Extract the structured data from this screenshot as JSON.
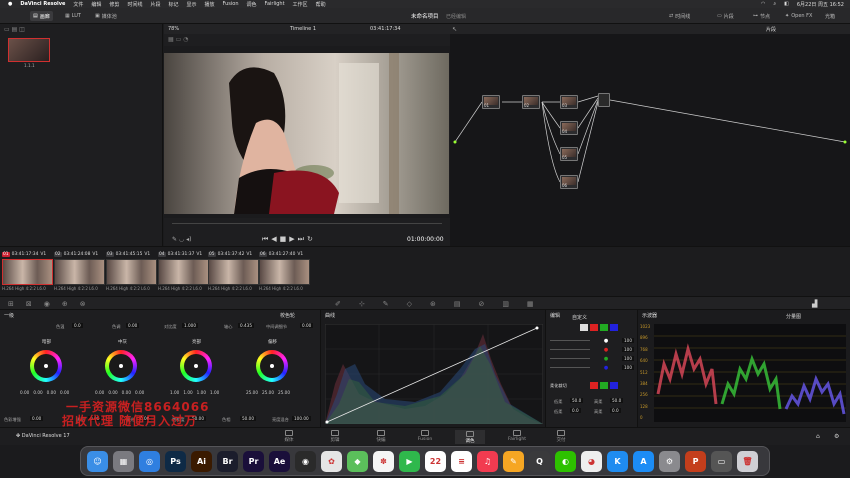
{
  "menubar": {
    "app": "DaVinci Resolve",
    "items": [
      "文件",
      "编辑",
      "修剪",
      "时间线",
      "片段",
      "标记",
      "显示",
      "播放",
      "Fusion",
      "调色",
      "Fairlight",
      "工作区",
      "帮助"
    ],
    "clock": "6月22日 周五 16:52"
  },
  "toolbar": {
    "media_pool": "画廊",
    "lut": "LUT",
    "media": "媒体池",
    "project_title": "未命名项目",
    "edited": "已经编辑",
    "timeline_label": "时间线",
    "clips": "片段",
    "nodes": "节点",
    "openfx": "Open FX",
    "lightbox": "光箱"
  },
  "gallery": {
    "still_label": "1.1.1"
  },
  "viewer": {
    "zoom": "78%",
    "timeline": "Timeline 1",
    "timecode_top": "03:41:17:34",
    "clip_label": "视频片段",
    "timecode": "01:00:00:00"
  },
  "nodes_panel": {
    "mode": "片段",
    "node_labels": [
      "01",
      "02",
      "03",
      "04",
      "05",
      "06"
    ]
  },
  "clips": [
    {
      "num": "01",
      "tc": "03:41:17:34",
      "track": "V1",
      "codec": "H.264 High 4:2:2 L6.0"
    },
    {
      "num": "02",
      "tc": "03:41:24:08",
      "track": "V1",
      "codec": "H.264 High 4:2:2 L6.0"
    },
    {
      "num": "03",
      "tc": "03:41:45:15",
      "track": "V1",
      "codec": "H.264 High 4:2:2 L6.0"
    },
    {
      "num": "04",
      "tc": "03:41:31:37",
      "track": "V1",
      "codec": "H.264 High 4:2:2 L6.0"
    },
    {
      "num": "05",
      "tc": "03:41:37:42",
      "track": "V1",
      "codec": "H.264 High 4:2:2 L6.0"
    },
    {
      "num": "06",
      "tc": "03:41:27:40",
      "track": "V1",
      "codec": "H.264 High 4:2:2 L6.0"
    }
  ],
  "wheels_panel": {
    "title": "一级",
    "mode": "校色轮",
    "contrast_label": "色温",
    "contrast": "0.0",
    "tint_label": "色调",
    "tint": "0.00",
    "cont_label": "对比度",
    "cont": "1.000",
    "pivot_label": "轴心",
    "pivot": "0.435",
    "mid_label": "中间调细节",
    "mid": "0.00",
    "wheels": [
      {
        "label": "暗部",
        "values": [
          "0.00",
          "0.00",
          "0.00",
          "0.00"
        ]
      },
      {
        "label": "中灰",
        "values": [
          "0.00",
          "0.00",
          "0.00",
          "0.00"
        ]
      },
      {
        "label": "亮部",
        "values": [
          "1.00",
          "1.00",
          "1.00",
          "1.00"
        ]
      },
      {
        "label": "偏移",
        "values": [
          "25.00",
          "25.00",
          "25.00"
        ]
      }
    ],
    "bottom": {
      "b1_label": "色彩增强",
      "b1": "0.00",
      "b2_label": "阴影",
      "b2": "0.00",
      "b3_label": "高光",
      "b3": "0.00",
      "b4_label": "饱和度",
      "b4": "50.00",
      "b5_label": "色相",
      "b5": "50.00",
      "b6_label": "亮度混合",
      "b6": "100.00"
    }
  },
  "curves_panel": {
    "title": "曲线"
  },
  "curves_rgb": {
    "edit_label": "编辑",
    "mode": "自定义",
    "values": [
      "100",
      "100",
      "100",
      "100"
    ],
    "soft_label": "柔化裁切",
    "low_label": "低柔",
    "low": "50.0",
    "high_label": "高柔",
    "high": "50.0",
    "ls_label": "低柔",
    "ls": "0.0",
    "hs_label": "高柔",
    "hs": "0.0"
  },
  "scopes_panel": {
    "title": "示波器",
    "mode": "分量图",
    "ticks": [
      "1023",
      "896",
      "768",
      "640",
      "512",
      "384",
      "256",
      "128",
      "0"
    ]
  },
  "pages": [
    {
      "label": "媒体"
    },
    {
      "label": "剪辑"
    },
    {
      "label": "快编"
    },
    {
      "label": "Fusion"
    },
    {
      "label": "调色"
    },
    {
      "label": "Fairlight"
    },
    {
      "label": "交付"
    }
  ],
  "footer_brand": "DaVinci Resolve 17",
  "watermark": {
    "line1": "一手资源微信8664066",
    "line2": "招收代理 随便月入过万"
  },
  "dock": [
    {
      "name": "finder-icon",
      "glyph": "☺",
      "color": "#3a8ee6"
    },
    {
      "name": "launchpad-icon",
      "glyph": "▦",
      "color": "#7a7a80"
    },
    {
      "name": "safari-icon",
      "glyph": "◎",
      "color": "#2f7fe0"
    },
    {
      "name": "photoshop-icon",
      "glyph": "Ps",
      "color": "#0e2a46"
    },
    {
      "name": "illustrator-icon",
      "glyph": "Ai",
      "color": "#3a1a00"
    },
    {
      "name": "bridge-icon",
      "glyph": "Br",
      "color": "#1b1d2c"
    },
    {
      "name": "premiere-icon",
      "glyph": "Pr",
      "color": "#1a0f3a"
    },
    {
      "name": "aftereffects-icon",
      "glyph": "Ae",
      "color": "#1a0f3a"
    },
    {
      "name": "davinci-icon",
      "glyph": "◉",
      "color": "#2a2a2a"
    },
    {
      "name": "pinwheel-icon",
      "glyph": "✿",
      "color": "#e5e5e5"
    },
    {
      "name": "maps-icon",
      "glyph": "◆",
      "color": "#5bbf5b"
    },
    {
      "name": "photos-icon",
      "glyph": "✽",
      "color": "#f5f5f5"
    },
    {
      "name": "facetime-icon",
      "glyph": "▶",
      "color": "#2fb84c"
    },
    {
      "name": "calendar-icon",
      "glyph": "22",
      "color": "#ffffff"
    },
    {
      "name": "reminders-icon",
      "glyph": "≡",
      "color": "#ffffff"
    },
    {
      "name": "music-icon",
      "glyph": "♫",
      "color": "#f23b50"
    },
    {
      "name": "pages-icon",
      "glyph": "✎",
      "color": "#f6a623"
    },
    {
      "name": "quicktime-icon",
      "glyph": "Q",
      "color": "#3a3a3c"
    },
    {
      "name": "wechat-icon",
      "glyph": "◐",
      "color": "#2dc100"
    },
    {
      "name": "qq-icon",
      "glyph": "◕",
      "color": "#eeeeee"
    },
    {
      "name": "kugou-icon",
      "glyph": "K",
      "color": "#1f8cf0"
    },
    {
      "name": "appstore-icon",
      "glyph": "A",
      "color": "#1c8cf5"
    },
    {
      "name": "settings-icon",
      "glyph": "⚙",
      "color": "#8a8a8e"
    },
    {
      "name": "powerpoint-icon",
      "glyph": "P",
      "color": "#c43e1c"
    },
    {
      "name": "screen-icon",
      "glyph": "▭",
      "color": "#555"
    },
    {
      "name": "trash-icon",
      "glyph": "🗑",
      "color": "#cfcfd4"
    }
  ]
}
